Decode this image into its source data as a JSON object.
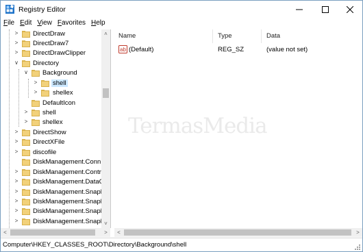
{
  "window": {
    "title": "Registry Editor"
  },
  "menu": [
    "File",
    "Edit",
    "View",
    "Favorites",
    "Help"
  ],
  "tree": {
    "items": [
      {
        "label": "DirectDraw"
      },
      {
        "label": "DirectDraw7"
      },
      {
        "label": "DirectDrawClipper"
      },
      {
        "label": "Directory"
      },
      {
        "label": "Background"
      },
      {
        "label": "shell"
      },
      {
        "label": "shellex"
      },
      {
        "label": "DefaultIcon"
      },
      {
        "label": "shell"
      },
      {
        "label": "shellex"
      },
      {
        "label": "DirectShow"
      },
      {
        "label": "DirectXFile"
      },
      {
        "label": "discofile"
      },
      {
        "label": "DiskManagement.Conn"
      },
      {
        "label": "DiskManagement.Contr"
      },
      {
        "label": "DiskManagement.DataC"
      },
      {
        "label": "DiskManagement.Snapl"
      },
      {
        "label": "DiskManagement.Snapl"
      },
      {
        "label": "DiskManagement.Snapl"
      },
      {
        "label": "DiskManagement.Snapl"
      }
    ]
  },
  "list": {
    "headers": {
      "name": "Name",
      "type": "Type",
      "data": "Data"
    },
    "rows": [
      {
        "name": "(Default)",
        "type": "REG_SZ",
        "data": "(value not set)"
      }
    ]
  },
  "status": {
    "path": "Computer\\HKEY_CLASSES_ROOT\\Directory\\Background\\shell"
  },
  "watermark": "TermasMedia"
}
